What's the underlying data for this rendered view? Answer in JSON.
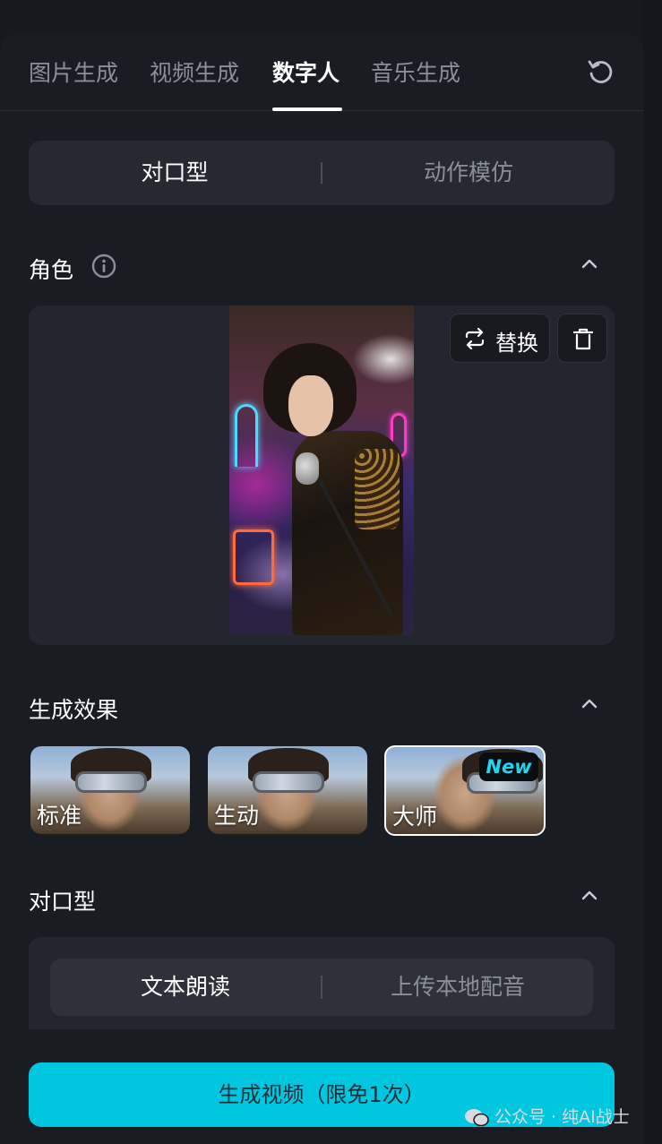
{
  "tabs": [
    {
      "label": "图片生成",
      "active": false
    },
    {
      "label": "视频生成",
      "active": false
    },
    {
      "label": "数字人",
      "active": true
    },
    {
      "label": "音乐生成",
      "active": false
    }
  ],
  "mode_switch": {
    "options": [
      "对口型",
      "动作模仿"
    ],
    "selected": "对口型"
  },
  "character": {
    "title": "角色",
    "replace_label": "替换"
  },
  "effect": {
    "title": "生成效果",
    "options": [
      {
        "label": "标准",
        "selected": false
      },
      {
        "label": "生动",
        "selected": false
      },
      {
        "label": "大师",
        "selected": true,
        "badge": "New"
      }
    ]
  },
  "lip_sync": {
    "title": "对口型",
    "options": [
      "文本朗读",
      "上传本地配音"
    ],
    "selected": "文本朗读"
  },
  "generate_button": "生成视频（限免1次）",
  "watermark": "公众号 · 纯AI战士",
  "colors": {
    "accent": "#00c6df",
    "panel": "#1a1c23",
    "card": "#23262e",
    "badge_text": "#1fd6f0"
  }
}
